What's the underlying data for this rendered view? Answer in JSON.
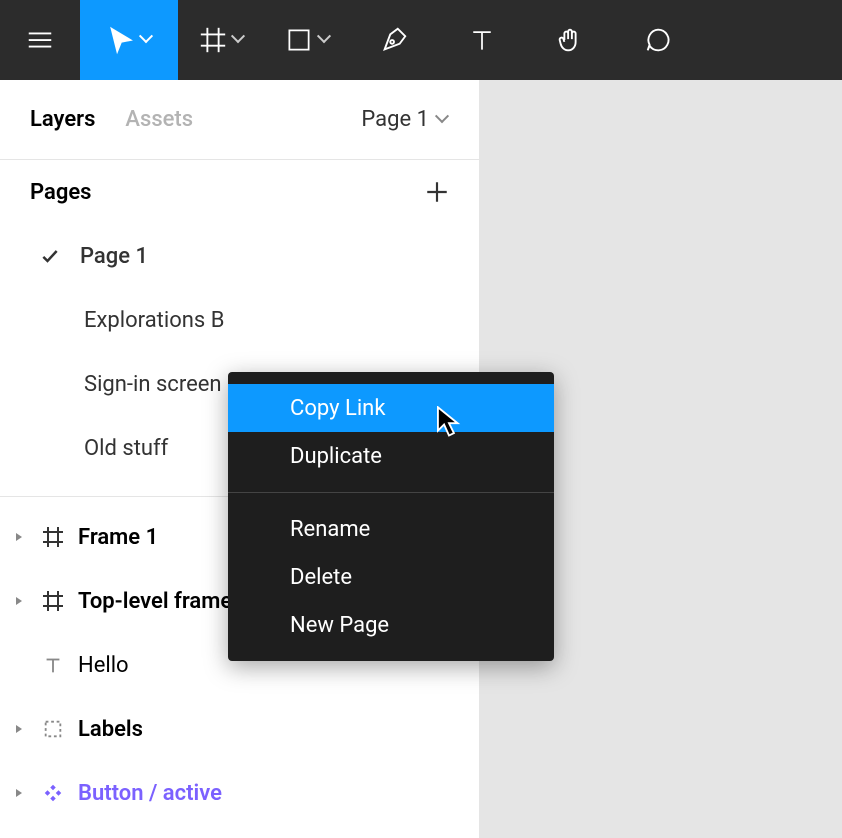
{
  "toolbar": {
    "tools": [
      "menu",
      "move",
      "frame",
      "shape",
      "pen",
      "text",
      "hand",
      "comment"
    ]
  },
  "panel": {
    "tabs": {
      "layers": "Layers",
      "assets": "Assets"
    },
    "activeTab": "layers",
    "currentPage": "Page 1"
  },
  "pages": {
    "title": "Pages",
    "items": [
      {
        "label": "Page 1",
        "selected": true
      },
      {
        "label": "Explorations B",
        "selected": false
      },
      {
        "label": "Sign-in screen",
        "selected": false
      },
      {
        "label": "Old stuff",
        "selected": false
      }
    ]
  },
  "layers": [
    {
      "type": "frame",
      "label": "Frame 1",
      "expandable": true
    },
    {
      "type": "frame",
      "label": "Top-level frame",
      "expandable": true
    },
    {
      "type": "text",
      "label": "Hello",
      "expandable": false
    },
    {
      "type": "group",
      "label": "Labels",
      "expandable": true
    },
    {
      "type": "component",
      "label": "Button / active",
      "expandable": true
    }
  ],
  "contextMenu": {
    "groups": [
      [
        "Copy Link",
        "Duplicate"
      ],
      [
        "Rename",
        "Delete",
        "New Page"
      ]
    ],
    "hovered": "Copy Link"
  },
  "colors": {
    "accent": "#0d99ff",
    "component": "#7b61ff",
    "toolbar": "#2c2c2c",
    "menu": "#1e1e1e"
  }
}
